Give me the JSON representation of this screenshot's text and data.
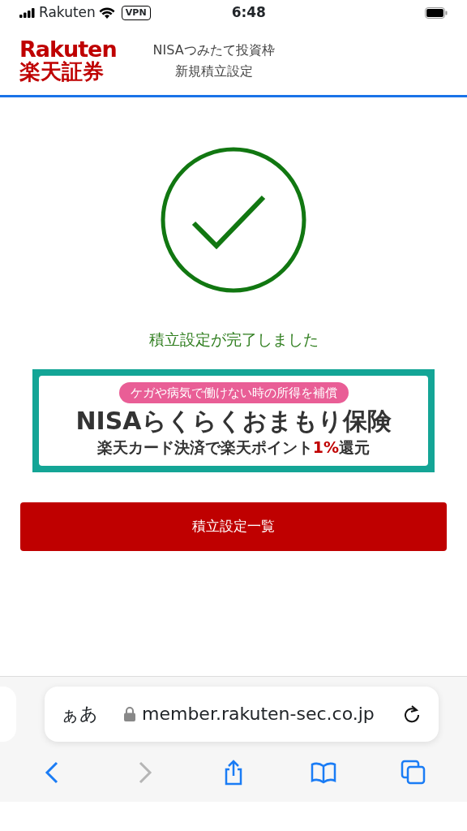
{
  "status_bar": {
    "carrier": "Rakuten",
    "vpn": "VPN",
    "time": "6:48"
  },
  "header": {
    "logo_top": "Rakuten",
    "logo_bottom": "楽天証券",
    "title": "NISAつみたて投資枠",
    "subtitle": "新規積立設定"
  },
  "message": "積立設定が完了しました",
  "banner": {
    "tagline": "ケガや病気で働けない時の所得を補償",
    "headline": "NISAらくらくおまもり保険",
    "reward_before": "楽天カード決済で楽天ポイント",
    "reward_highlight": "1%",
    "reward_after": "還元"
  },
  "button": "積立設定一覧",
  "browser": {
    "text_size": "ぁあ",
    "url": "member.rakuten-sec.co.jp",
    "toolbar": [
      {
        "kind": "back",
        "disabled": false
      },
      {
        "kind": "forward",
        "disabled": true
      },
      {
        "kind": "share",
        "disabled": false
      },
      {
        "kind": "bookmarks",
        "disabled": false
      },
      {
        "kind": "tabs",
        "disabled": false
      }
    ]
  }
}
